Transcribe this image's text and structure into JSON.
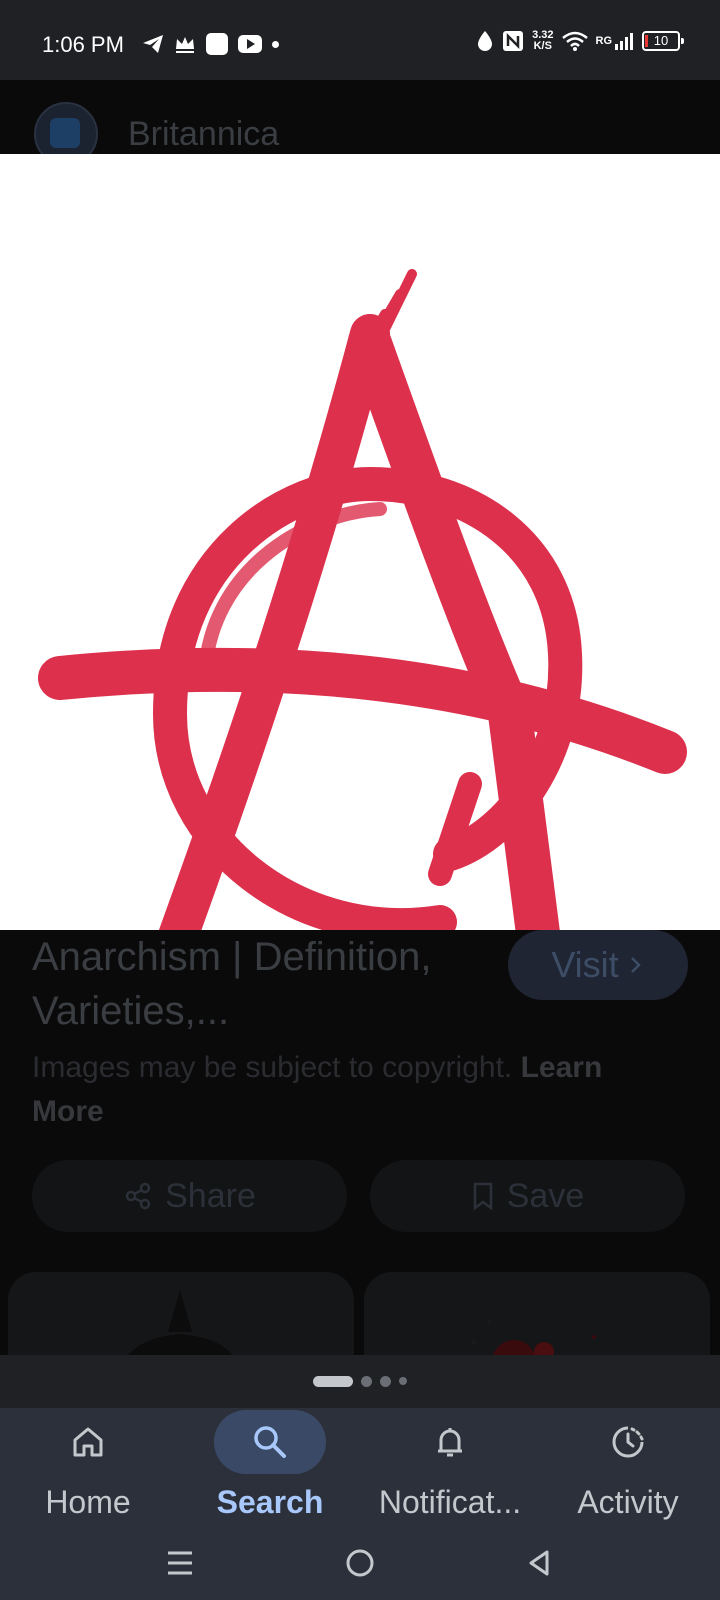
{
  "status_bar": {
    "time": "1:06 PM",
    "net_speed_value": "3.32",
    "net_speed_unit": "K/S",
    "carrier": "RG",
    "battery": "10"
  },
  "source": {
    "name": "Britannica"
  },
  "result": {
    "title": "Anarchism | Definition, Varieties,...",
    "visit_label": "Visit",
    "copyright_text": "Images may be subject to copyright.",
    "learn_more_label": "Learn More",
    "share_label": "Share",
    "save_label": "Save"
  },
  "image": {
    "color": "#dc304c",
    "background": "#ffffff"
  },
  "pager": {
    "active_index": 0,
    "count": 4
  },
  "bottom_nav": {
    "items": [
      {
        "label": "Home",
        "icon": "home-icon"
      },
      {
        "label": "Search",
        "icon": "search-icon",
        "active": true
      },
      {
        "label": "Notificat...",
        "icon": "bell-icon"
      },
      {
        "label": "Activity",
        "icon": "activity-icon"
      }
    ]
  },
  "colors": {
    "accent": "#a8c7fa",
    "nav_background": "#2b303b"
  }
}
